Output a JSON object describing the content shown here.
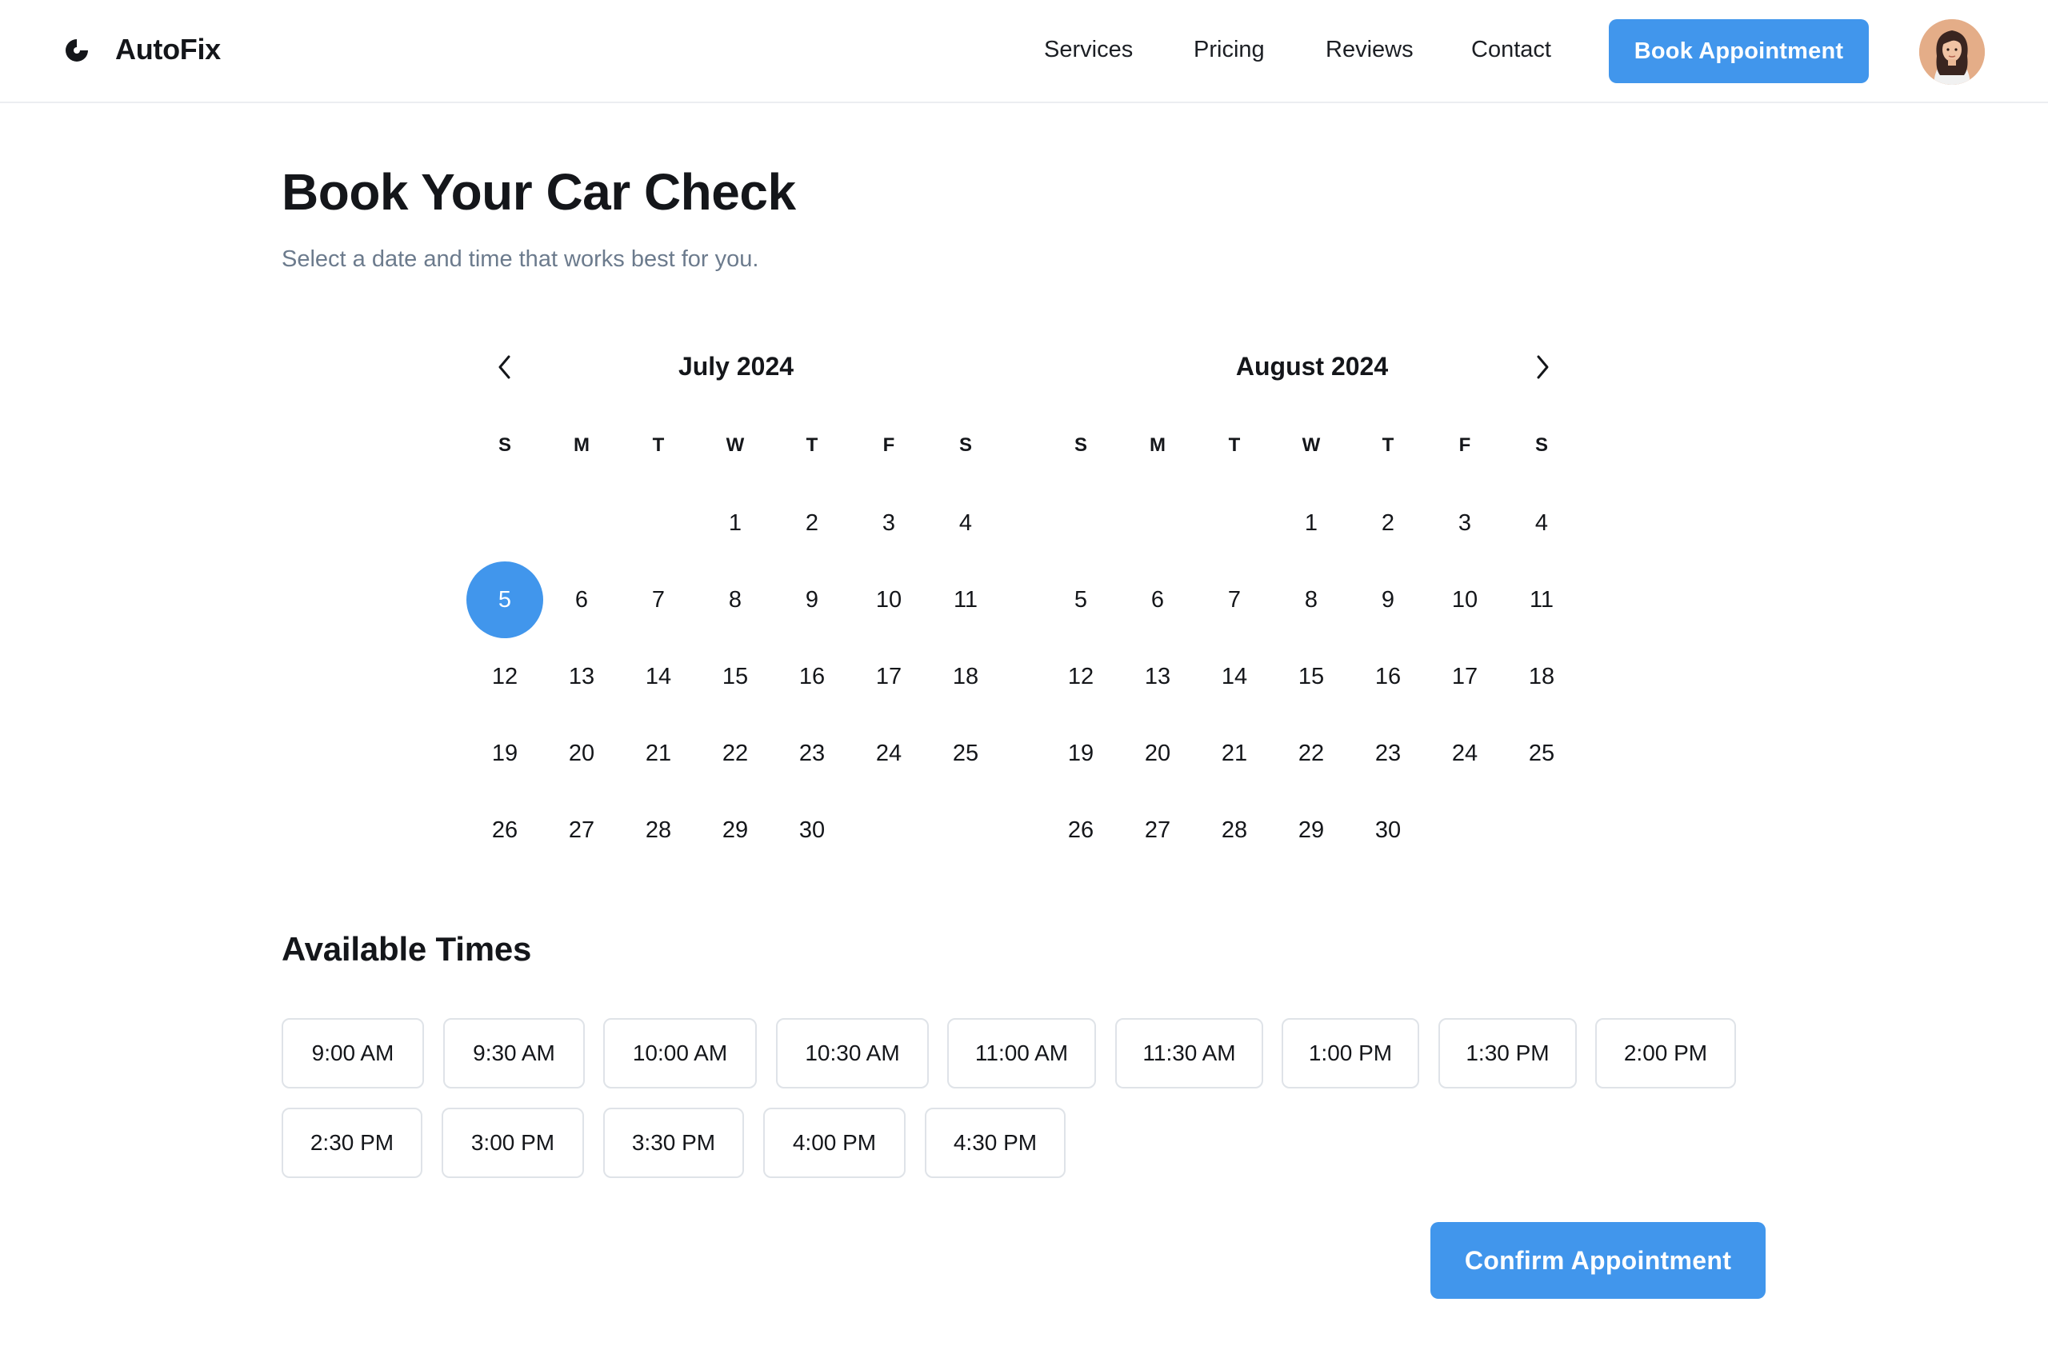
{
  "app": {
    "brand": "AutoFix",
    "logo_icon": "half-circle-logo-icon",
    "accent_color": "#4196ec"
  },
  "nav": {
    "services": "Services",
    "pricing": "Pricing",
    "reviews": "Reviews",
    "contact": "Contact",
    "cta": "Book Appointment"
  },
  "header": {
    "title": "Book Your Car Check",
    "subtitle": "Select a date and time that works best for you."
  },
  "calendar": {
    "prev_icon": "chevron-left-icon",
    "next_icon": "chevron-right-icon",
    "weekdays": [
      "S",
      "M",
      "T",
      "W",
      "T",
      "F",
      "S"
    ],
    "months": [
      {
        "title": "July 2024",
        "first_weekday_index": 3,
        "days": [
          "1",
          "2",
          "3",
          "4",
          "5",
          "6",
          "7",
          "8",
          "9",
          "10",
          "11",
          "12",
          "13",
          "14",
          "15",
          "16",
          "17",
          "18",
          "19",
          "20",
          "21",
          "22",
          "23",
          "24",
          "25",
          "26",
          "27",
          "28",
          "29",
          "30"
        ]
      },
      {
        "title": "August 2024",
        "first_weekday_index": 3,
        "days": [
          "1",
          "2",
          "3",
          "4",
          "5",
          "6",
          "7",
          "8",
          "9",
          "10",
          "11",
          "12",
          "13",
          "14",
          "15",
          "16",
          "17",
          "18",
          "19",
          "20",
          "21",
          "22",
          "23",
          "24",
          "25",
          "26",
          "27",
          "28",
          "29",
          "30"
        ]
      }
    ],
    "selected": {
      "month_index": 0,
      "day": "5"
    }
  },
  "times": {
    "heading": "Available Times",
    "slots": [
      "9:00 AM",
      "9:30 AM",
      "10:00 AM",
      "10:30 AM",
      "11:00 AM",
      "11:30 AM",
      "1:00 PM",
      "1:30 PM",
      "2:00 PM",
      "2:30 PM",
      "3:00 PM",
      "3:30 PM",
      "4:00 PM",
      "4:30 PM"
    ]
  },
  "actions": {
    "confirm": "Confirm Appointment"
  }
}
